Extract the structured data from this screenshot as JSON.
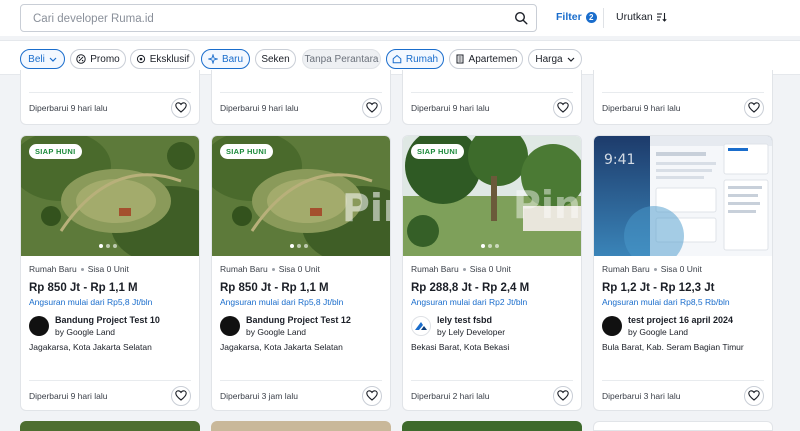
{
  "search": {
    "placeholder": "Cari developer Ruma.id",
    "value": ""
  },
  "header": {
    "filter_label": "Filter",
    "filter_count": "2",
    "sort_label": "Urutkan"
  },
  "chips": [
    {
      "label": "Beli",
      "active": true
    },
    {
      "label": "Promo",
      "active": false
    },
    {
      "label": "Eksklusif",
      "active": false
    },
    {
      "label": "Baru",
      "active": true
    },
    {
      "label": "Seken",
      "active": false
    },
    {
      "label": "Tanpa Perantara",
      "active": false,
      "disabled": true
    },
    {
      "label": "Rumah",
      "active": true
    },
    {
      "label": "Apartemen",
      "active": false
    },
    {
      "label": "Harga",
      "active": false
    }
  ],
  "top_row_updated": [
    "Diperbarui 9 hari lalu",
    "Diperbarui 9 hari lalu",
    "Diperbarui 9 hari lalu",
    "Diperbarui 9 hari lalu"
  ],
  "listings": [
    {
      "badge": "SIAP HUNI",
      "type": "Rumah Baru",
      "units": "Sisa 0 Unit",
      "price": "Rp 850 Jt - Rp 1,1 M",
      "installment": "Angsuran mulai dari Rp5,8 Jt/bln",
      "project": "Bandung Project Test 10",
      "developer": "by Google Land",
      "location": "Jagakarsa, Kota Jakarta Selatan",
      "updated": "Diperbarui 9 hari lalu",
      "photo_icon": "aerial-photo"
    },
    {
      "badge": "SIAP HUNI",
      "type": "Rumah Baru",
      "units": "Sisa 0 Unit",
      "price": "Rp 850 Jt - Rp 1,1 M",
      "installment": "Angsuran mulai dari Rp5,8 Jt/bln",
      "project": "Bandung Project Test 12",
      "developer": "by Google Land",
      "location": "Jagakarsa, Kota Jakarta Selatan",
      "updated": "Diperbarui 3 jam lalu",
      "photo_icon": "aerial-photo"
    },
    {
      "badge": "SIAP HUNI",
      "type": "Rumah Baru",
      "units": "Sisa 0 Unit",
      "price": "Rp 288,8 Jt - Rp 2,4 M",
      "installment": "Angsuran mulai dari Rp2 Jt/bln",
      "project": "lely test fsbd",
      "developer": "by Lely Developer",
      "location": "Bekasi Barat, Kota Bekasi",
      "updated": "Diperbarui 2 hari lalu",
      "photo_icon": "garden-photo"
    },
    {
      "badge": "",
      "type": "Rumah Baru",
      "units": "Sisa 0 Unit",
      "price": "Rp 1,2 Jt - Rp 12,3 Jt",
      "installment": "Angsuran mulai dari Rp8,5 Rb/bln",
      "project": "test project 16 april 2024",
      "developer": "by Google Land",
      "location": "Bula Barat, Kab. Seram Bagian Timur",
      "updated": "Diperbarui 3 hari lalu",
      "photo_icon": "screenshot-photo",
      "photo_time": "9:41"
    }
  ],
  "watermark": "Pinhome",
  "colors": {
    "accent": "#1a6dcc",
    "badge_green": "#1a8a3a"
  }
}
